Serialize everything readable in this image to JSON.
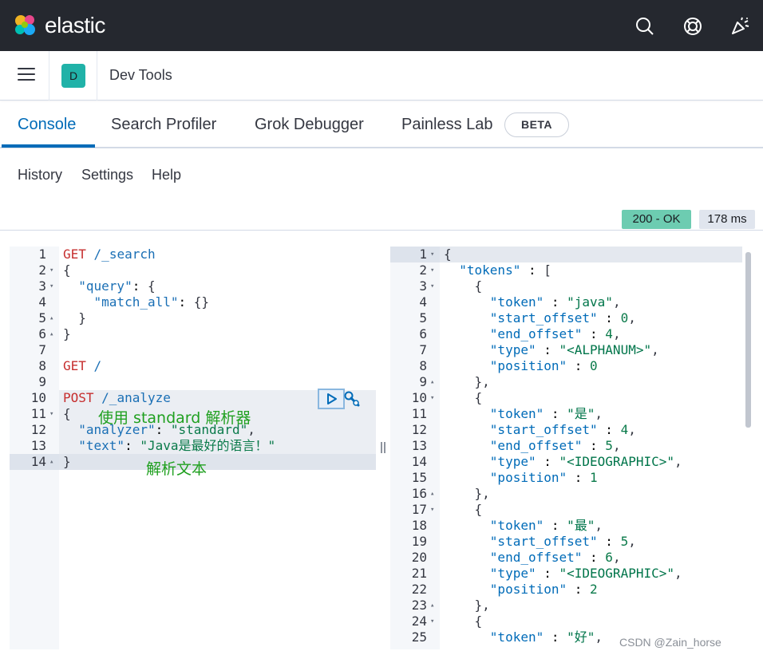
{
  "header": {
    "brand": "elastic",
    "icons": [
      "search-icon",
      "help-icon",
      "news-icon"
    ]
  },
  "breadcrumb": {
    "space_initial": "D",
    "title": "Dev Tools"
  },
  "tabs": [
    {
      "label": "Console",
      "active": true
    },
    {
      "label": "Search Profiler",
      "active": false
    },
    {
      "label": "Grok Debugger",
      "active": false
    },
    {
      "label": "Painless Lab",
      "active": false
    }
  ],
  "beta_badge": "BETA",
  "menu": {
    "history": "History",
    "settings": "Settings",
    "help": "Help"
  },
  "status": {
    "code": "200 - OK",
    "time": "178 ms"
  },
  "request_editor": {
    "line_numbers": [
      "1",
      "2",
      "3",
      "4",
      "5",
      "6",
      "7",
      "8",
      "9",
      "10",
      "11",
      "12",
      "13",
      "14"
    ],
    "lines": [
      "GET /_search",
      "{",
      "  \"query\": {",
      "    \"match_all\": {}",
      "  }",
      "}",
      "",
      "GET /",
      "",
      "POST /_analyze",
      "{",
      "  \"analyzer\": \"standard\",",
      "  \"text\": \"Java是最好的语言！\"",
      "}"
    ],
    "annotations": {
      "analyzer_note": "使用 standard 解析器",
      "text_note": "解析文本"
    }
  },
  "response_editor": {
    "line_numbers": [
      "1",
      "2",
      "3",
      "4",
      "5",
      "6",
      "7",
      "8",
      "9",
      "10",
      "11",
      "12",
      "13",
      "14",
      "15",
      "16",
      "17",
      "18",
      "19",
      "20",
      "21",
      "22",
      "23",
      "24",
      "25"
    ],
    "lines": [
      "{",
      "  \"tokens\" : [",
      "    {",
      "      \"token\" : \"java\",",
      "      \"start_offset\" : 0,",
      "      \"end_offset\" : 4,",
      "      \"type\" : \"<ALPHANUM>\",",
      "      \"position\" : 0",
      "    },",
      "    {",
      "      \"token\" : \"是\",",
      "      \"start_offset\" : 4,",
      "      \"end_offset\" : 5,",
      "      \"type\" : \"<IDEOGRAPHIC>\",",
      "      \"position\" : 1",
      "    },",
      "    {",
      "      \"token\" : \"最\",",
      "      \"start_offset\" : 5,",
      "      \"end_offset\" : 6,",
      "      \"type\" : \"<IDEOGRAPHIC>\",",
      "      \"position\" : 2",
      "    },",
      "    {",
      "      \"token\" : \"好\","
    ]
  },
  "watermark": "CSDN @Zain_horse"
}
